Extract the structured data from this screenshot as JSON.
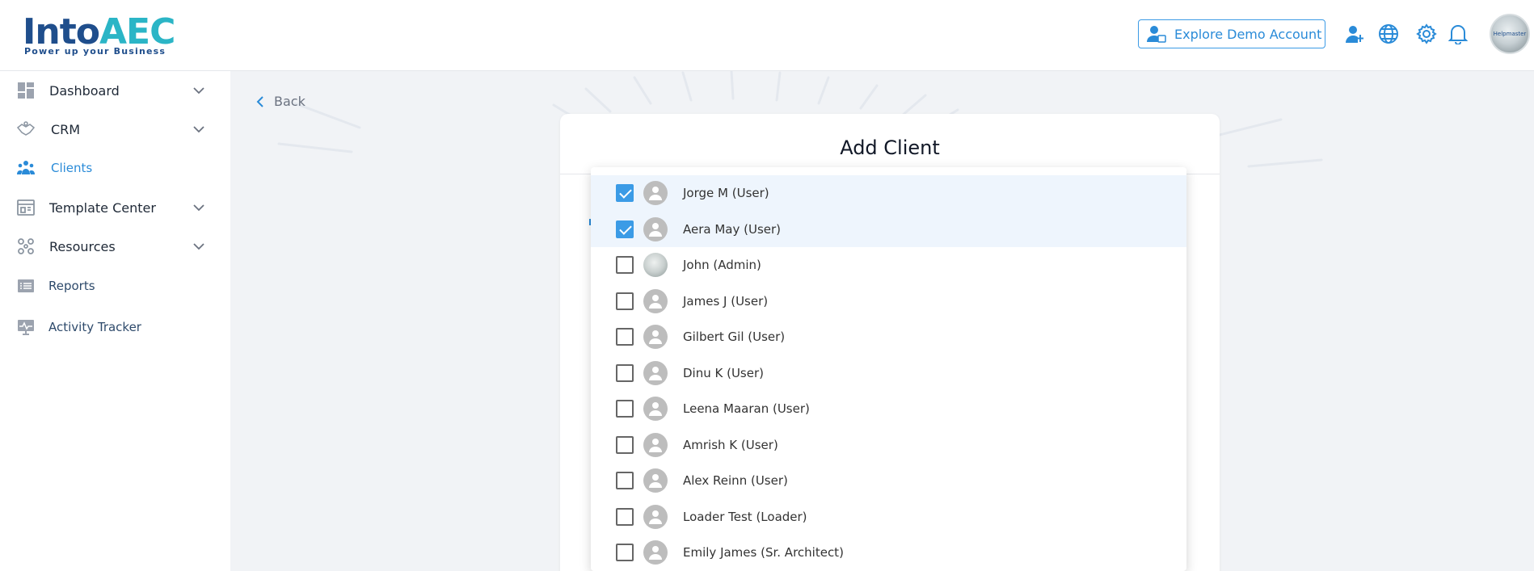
{
  "brand": {
    "name_a": "Into",
    "name_b": "AEC",
    "tagline": "Power up your Business"
  },
  "header": {
    "demo_button": "Explore Demo Account",
    "avatar_text": "Helpmaster"
  },
  "sidebar": {
    "items": [
      {
        "label": "Dashboard",
        "icon": "dashboard-icon",
        "has_chevron": true
      },
      {
        "label": "CRM",
        "icon": "crm-handshake-icon",
        "has_chevron": true
      },
      {
        "label": "Clients",
        "icon": "clients-group-icon",
        "active": true
      },
      {
        "label": "Template Center",
        "icon": "template-icon",
        "has_chevron": true
      },
      {
        "label": "Resources",
        "icon": "resources-icon",
        "has_chevron": true
      },
      {
        "label": "Reports",
        "icon": "reports-list-icon"
      },
      {
        "label": "Activity Tracker",
        "icon": "activity-monitor-icon"
      }
    ]
  },
  "main": {
    "back_label": "Back",
    "card_title": "Add Client",
    "dropdown": {
      "options": [
        {
          "label": "Jorge M (User)",
          "checked": true
        },
        {
          "label": "Aera May (User)",
          "checked": true
        },
        {
          "label": "John (Admin)",
          "checked": false,
          "photo": true
        },
        {
          "label": "James J (User)",
          "checked": false
        },
        {
          "label": "Gilbert Gil (User)",
          "checked": false
        },
        {
          "label": "Dinu K (User)",
          "checked": false
        },
        {
          "label": "Leena Maaran (User)",
          "checked": false
        },
        {
          "label": "Amrish K (User)",
          "checked": false
        },
        {
          "label": "Alex Reinn (User)",
          "checked": false
        },
        {
          "label": "Loader Test (Loader)",
          "checked": false
        },
        {
          "label": "Emily James (Sr. Architect)",
          "checked": false
        }
      ]
    }
  },
  "colors": {
    "accent": "#2a8bd8",
    "brand_dark": "#1f4e8c",
    "brand_teal": "#2bb5c6",
    "selected_row": "#eef5fd"
  }
}
